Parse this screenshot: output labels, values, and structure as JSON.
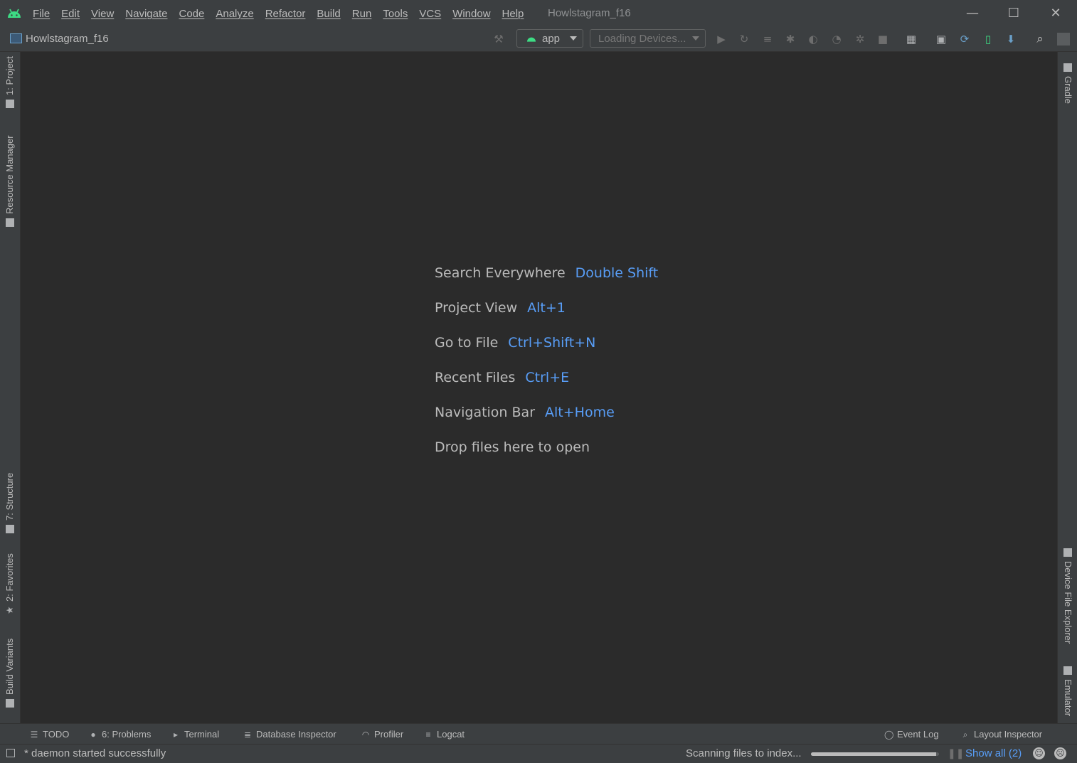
{
  "window": {
    "title": "Howlstagram_f16",
    "controls": {
      "minimize": "—",
      "maximize": "☐",
      "close": "✕"
    }
  },
  "menu": {
    "items": [
      "File",
      "Edit",
      "View",
      "Navigate",
      "Code",
      "Analyze",
      "Refactor",
      "Build",
      "Run",
      "Tools",
      "VCS",
      "Window",
      "Help"
    ]
  },
  "navbar": {
    "project_name": "Howlstagram_f16",
    "run_config": "app",
    "device_selector": "Loading Devices..."
  },
  "left_tool_tabs": [
    "1: Project",
    "Resource Manager",
    "7: Structure",
    "2: Favorites",
    "Build Variants"
  ],
  "right_tool_tabs": [
    "Gradle",
    "Device File Explorer",
    "Emulator"
  ],
  "empty_editor_hints": [
    {
      "action": "Search Everywhere",
      "shortcut": "Double Shift"
    },
    {
      "action": "Project View",
      "shortcut": "Alt+1"
    },
    {
      "action": "Go to File",
      "shortcut": "Ctrl+Shift+N"
    },
    {
      "action": "Recent Files",
      "shortcut": "Ctrl+E"
    },
    {
      "action": "Navigation Bar",
      "shortcut": "Alt+Home"
    },
    {
      "action": "Drop files here to open",
      "shortcut": ""
    }
  ],
  "bottom_tool_tabs": {
    "todo": "TODO",
    "problems": "6: Problems",
    "terminal": "Terminal",
    "database_inspector": "Database Inspector",
    "profiler": "Profiler",
    "logcat": "Logcat",
    "event_log": "Event Log",
    "layout_inspector": "Layout Inspector"
  },
  "status_bar": {
    "message": "* daemon started successfully",
    "progress_text": "Scanning files to index...",
    "progress_fraction": 0.98,
    "show_all": "Show all (2)"
  },
  "colors": {
    "background": "#2b2b2b",
    "chrome": "#3c3f41",
    "text": "#bbbbbb",
    "link": "#589df6",
    "android_green": "#3ddc84"
  },
  "icons": [
    "android-logo-icon",
    "build-hammer-icon",
    "run-icon",
    "rerun-icon",
    "debug-icon",
    "stop-icon",
    "search-icon"
  ]
}
